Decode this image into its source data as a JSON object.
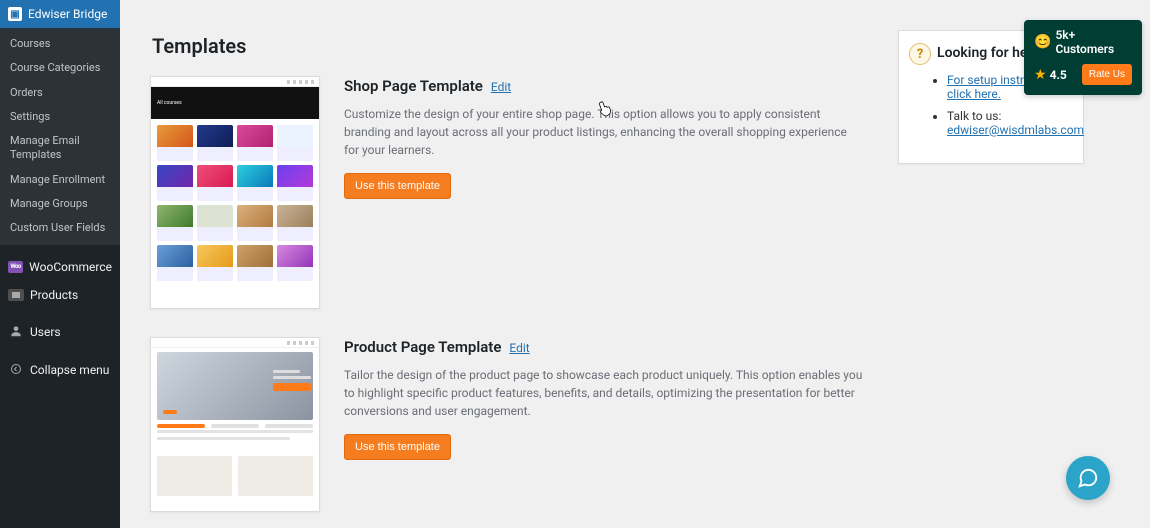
{
  "sidebar": {
    "active_plugin": "Edwiser Bridge",
    "submenu": [
      "Courses",
      "Course Categories",
      "Orders",
      "Settings",
      "Manage Email Templates",
      "Manage Enrollment",
      "Manage Groups",
      "Custom User Fields"
    ],
    "nav": {
      "woocommerce": "WooCommerce",
      "products": "Products",
      "users": "Users",
      "collapse": "Collapse menu"
    }
  },
  "page": {
    "title": "Templates"
  },
  "templates": [
    {
      "title": "Shop Page Template",
      "edit": "Edit",
      "desc": "Customize the design of your entire shop page. This option allows you to apply consistent branding and layout across all your product listings, enhancing the overall shopping experience for your learners.",
      "button": "Use this template"
    },
    {
      "title": "Product Page Template",
      "edit": "Edit",
      "desc": "Tailor the design of the product page to showcase each product uniquely. This option enables you to highlight specific product features, benefits, and details, optimizing the presentation for better conversions and user engagement.",
      "button": "Use this template"
    }
  ],
  "help": {
    "title": "Looking for help?",
    "items": {
      "setup_link": "For setup instructions, click here.",
      "talk_prefix": "Talk to us: ",
      "talk_email": "edwiser@wisdmlabs.com"
    }
  },
  "rate_widget": {
    "customers": "5k+ Customers",
    "rating": "4.5",
    "button": "Rate Us"
  },
  "thumb1_hero": "All courses"
}
